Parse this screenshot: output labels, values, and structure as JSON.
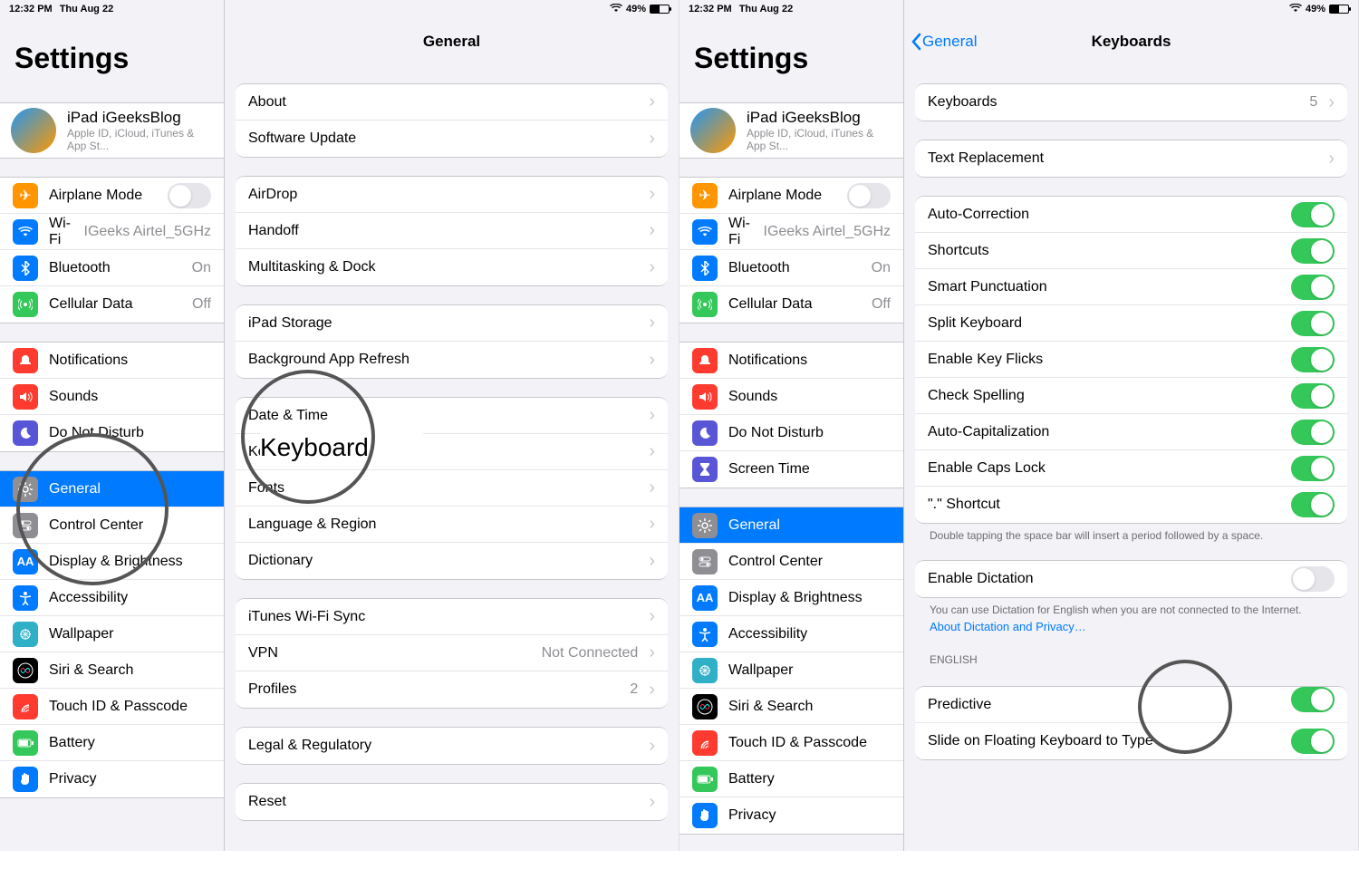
{
  "status": {
    "time": "12:32 PM",
    "date": "Thu Aug 22",
    "battery_pct": "49%",
    "battery_fill": 49
  },
  "left": {
    "title": "Settings",
    "profile": {
      "name": "iPad iGeeksBlog",
      "sub": "Apple ID, iCloud, iTunes & App St..."
    },
    "sidebar": [
      {
        "icon": "#ff9500",
        "glyph": "✈",
        "label": "Airplane Mode",
        "type": "switch",
        "on": false
      },
      {
        "icon": "#007aff",
        "glyph": "wifi",
        "label": "Wi-Fi",
        "value": "IGeeks Airtel_5GHz"
      },
      {
        "icon": "#007aff",
        "glyph": "bt",
        "label": "Bluetooth",
        "value": "On"
      },
      {
        "icon": "#34c759",
        "glyph": "ant",
        "label": "Cellular Data",
        "value": "Off"
      },
      "---",
      {
        "icon": "#ff3b30",
        "glyph": "bell",
        "label": "Notifications"
      },
      {
        "icon": "#ff3b30",
        "glyph": "snd",
        "label": "Sounds"
      },
      {
        "icon": "#5856d6",
        "glyph": "moon",
        "label": "Do Not Disturb"
      },
      {
        "icon": "#5856d6",
        "glyph": "hour",
        "label": "Screen Time"
      },
      "---",
      {
        "icon": "#8e8e93",
        "glyph": "gear",
        "label": "General",
        "selected": true
      },
      {
        "icon": "#8e8e93",
        "glyph": "ctrl",
        "label": "Control Center"
      },
      {
        "icon": "#007aff",
        "glyph": "AA",
        "label": "Display & Brightness"
      },
      {
        "icon": "#007aff",
        "glyph": "acc",
        "label": "Accessibility"
      },
      {
        "icon": "#30b0c7",
        "glyph": "wp",
        "label": "Wallpaper"
      },
      {
        "icon": "#000000",
        "glyph": "siri",
        "label": "Siri & Search"
      },
      {
        "icon": "#ff3b30",
        "glyph": "tid",
        "label": "Touch ID & Passcode"
      },
      {
        "icon": "#34c759",
        "glyph": "bat",
        "label": "Battery"
      },
      {
        "icon": "#007aff",
        "glyph": "hand",
        "label": "Privacy"
      }
    ],
    "detail_title": "General",
    "detail_groups": [
      [
        {
          "label": "About"
        },
        {
          "label": "Software Update"
        }
      ],
      [
        {
          "label": "AirDrop"
        },
        {
          "label": "Handoff"
        },
        {
          "label": "Multitasking & Dock"
        }
      ],
      [
        {
          "label": "iPad Storage"
        },
        {
          "label": "Background App Refresh"
        }
      ],
      [
        {
          "label": "Date & Time"
        },
        {
          "label": "Keyboard"
        },
        {
          "label": "Fonts"
        },
        {
          "label": "Language & Region"
        },
        {
          "label": "Dictionary"
        }
      ],
      [
        {
          "label": "iTunes Wi-Fi Sync"
        },
        {
          "label": "VPN",
          "value": "Not Connected"
        },
        {
          "label": "Profiles",
          "value": "2"
        }
      ],
      [
        {
          "label": "Legal & Regulatory"
        }
      ],
      [
        {
          "label": "Reset"
        }
      ]
    ],
    "magnified": "Keyboard"
  },
  "right": {
    "back": "General",
    "detail_title": "Keyboards",
    "keyboards_count": "5",
    "rows1": [
      {
        "label": "Keyboards",
        "value": "5"
      }
    ],
    "rows2": [
      {
        "label": "Text Replacement"
      }
    ],
    "toggles": [
      {
        "label": "Auto-Correction",
        "on": true
      },
      {
        "label": "Shortcuts",
        "on": true
      },
      {
        "label": "Smart Punctuation",
        "on": true
      },
      {
        "label": "Split Keyboard",
        "on": true
      },
      {
        "label": "Enable Key Flicks",
        "on": true
      },
      {
        "label": "Check Spelling",
        "on": true
      },
      {
        "label": "Auto-Capitalization",
        "on": true
      },
      {
        "label": "Enable Caps Lock",
        "on": true
      },
      {
        "label": "\".\" Shortcut",
        "on": true
      }
    ],
    "shortcut_note": "Double tapping the space bar will insert a period followed by a space.",
    "dictation": [
      {
        "label": "Enable Dictation",
        "on": false
      }
    ],
    "dictation_note": "You can use Dictation for English when you are not connected to the Internet.",
    "dictation_link": "About Dictation and Privacy…",
    "english_header": "English",
    "english_rows": [
      {
        "label": "Predictive",
        "on": true,
        "clip": true
      },
      {
        "label": "Slide on Floating Keyboard to Type",
        "on": true
      }
    ]
  }
}
